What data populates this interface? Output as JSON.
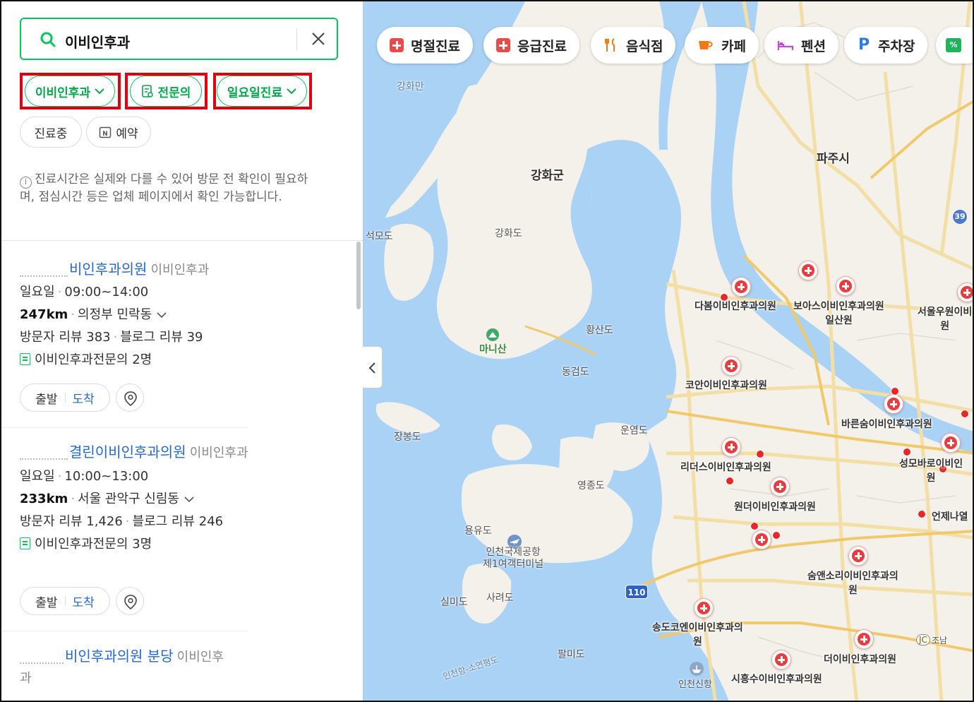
{
  "search": {
    "query": "이비인후과"
  },
  "filters": {
    "chips": [
      {
        "label": "이비인후과"
      },
      {
        "label": "전문의"
      },
      {
        "label": "일요일진료"
      }
    ],
    "secondary": [
      {
        "label": "진료중"
      },
      {
        "label": "예약"
      }
    ]
  },
  "notice": {
    "text": "진료시간은 실제와 다를 수 있어 방문 전 확인이 필요하며, 점심시간 등은 업체 페이지에서 확인 가능합니다."
  },
  "results": [
    {
      "name": "비인후과의원",
      "category": "이비인후과",
      "day": "일요일",
      "hours": "09:00~14:00",
      "distance": "247km",
      "area": "의정부 민락동",
      "visitor_reviews": "방문자 리뷰 383",
      "blog_reviews": "블로그 리뷰 39",
      "specialists": "이비인후과전문의 2명",
      "route_depart": "출발",
      "route_arrive": "도착"
    },
    {
      "name": "결린이비인후과의원",
      "category": "이비인후과",
      "day": "일요일",
      "hours": "10:00~13:00",
      "distance": "233km",
      "area": "서울 관악구 신림동",
      "visitor_reviews": "방문자 리뷰 1,426",
      "blog_reviews": "블로그 리뷰 246",
      "specialists": "이비인후과전문의 3명",
      "route_depart": "출발",
      "route_arrive": "도착"
    },
    {
      "name": "비인후과의원 분당",
      "category": "이비인후과"
    }
  ],
  "map": {
    "categories": [
      {
        "label": "명절진료",
        "icon": "medical-cross-icon"
      },
      {
        "label": "응급진료",
        "icon": "medical-cross-icon"
      },
      {
        "label": "음식점",
        "icon": "utensils-icon"
      },
      {
        "label": "카페",
        "icon": "coffee-cup-icon"
      },
      {
        "label": "펜션",
        "icon": "bed-icon"
      },
      {
        "label": "주차장",
        "icon": "parking-icon"
      }
    ],
    "places": {
      "ganghwa_gun": "강화군",
      "paju": "파주시",
      "ganghwa_do": "강화도",
      "seongmo": "석모도",
      "hwangsan": "황산도",
      "dongsum": "동검도",
      "manisan": "마니산",
      "jangbong": "장봉도",
      "unyeom": "운염도",
      "yeongjong": "영종도",
      "yongyu": "용유도",
      "airport": "인천국제공항\n제1여객터미널",
      "silmi": "실미도",
      "saryeok": "사려도",
      "palmi": "팔미도",
      "ferry": "인천항-소연평도",
      "incheon_new_port": "인천신항",
      "ganghwaman": "강화만",
      "jonal": "조남"
    },
    "route_shields": {
      "r39": "39",
      "r110": "110",
      "jc": "JC"
    },
    "hospitals": [
      {
        "label": "다봄이비인후과의원"
      },
      {
        "label": "보아스이비인후과의원\n일산원"
      },
      {
        "label": "서울우원이비\n원"
      },
      {
        "label": "코안이비인후과의원"
      },
      {
        "label": "바른숨이비인후과의원"
      },
      {
        "label": "리더스이비인후과의원"
      },
      {
        "label": "성모바로이비인\n원"
      },
      {
        "label": "원더이비인후과의원"
      },
      {
        "label": "언제나열"
      },
      {
        "label": "숨앤소리이비인후과의\n원"
      },
      {
        "label": "송도코엔이비인후과의\n원"
      },
      {
        "label": "더이비인후과의원"
      },
      {
        "label": "시흥수이비인후과의원"
      }
    ],
    "colors": {
      "sea": "#a9d2f5",
      "land": "#f4f1ea",
      "road": "#f3dfa6",
      "highway": "#f2c96a",
      "accent": "#03c75a",
      "highlight": "#e0000f"
    }
  }
}
